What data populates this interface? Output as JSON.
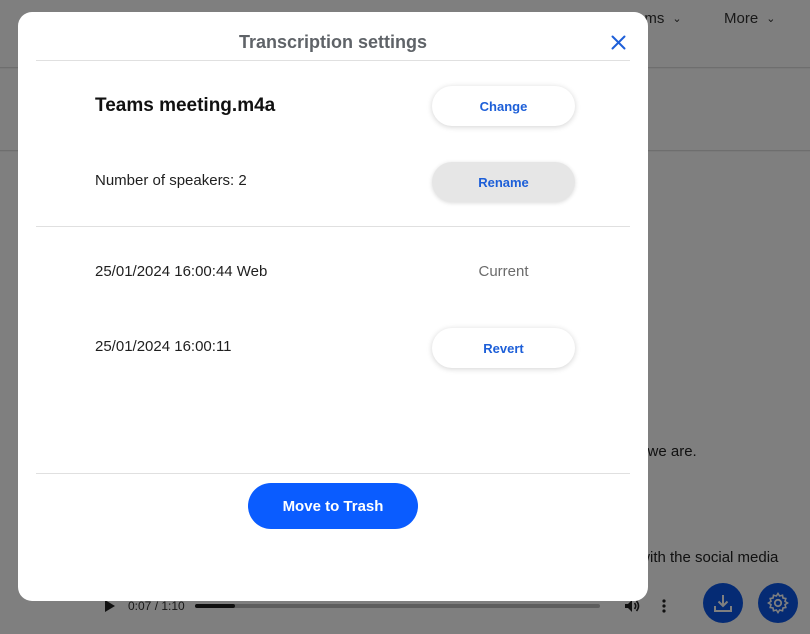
{
  "background": {
    "nav": [
      {
        "label": "ams"
      },
      {
        "label": "More"
      }
    ],
    "snippets": [
      "e we are.",
      "ck with the social media"
    ],
    "player": {
      "time": "0:07 / 1:10",
      "progress": 0.1
    }
  },
  "modal": {
    "title": "Transcription settings",
    "file_name": "Teams meeting.m4a",
    "change_label": "Change",
    "speakers_text": "Number of speakers: 2",
    "rename_label": "Rename",
    "versions": [
      {
        "label": "25/01/2024 16:00:44 Web",
        "status": "Current"
      },
      {
        "label": "25/01/2024 16:00:11",
        "action": "Revert"
      }
    ],
    "trash_label": "Move to Trash"
  },
  "colors": {
    "accent": "#0a5cff",
    "link": "#1d5fd8",
    "title": "#5f6368"
  },
  "icons": [
    "close-icon",
    "play-icon",
    "volume-icon",
    "more-vert-icon",
    "download-icon",
    "settings-icon",
    "chevron-down-icon"
  ]
}
